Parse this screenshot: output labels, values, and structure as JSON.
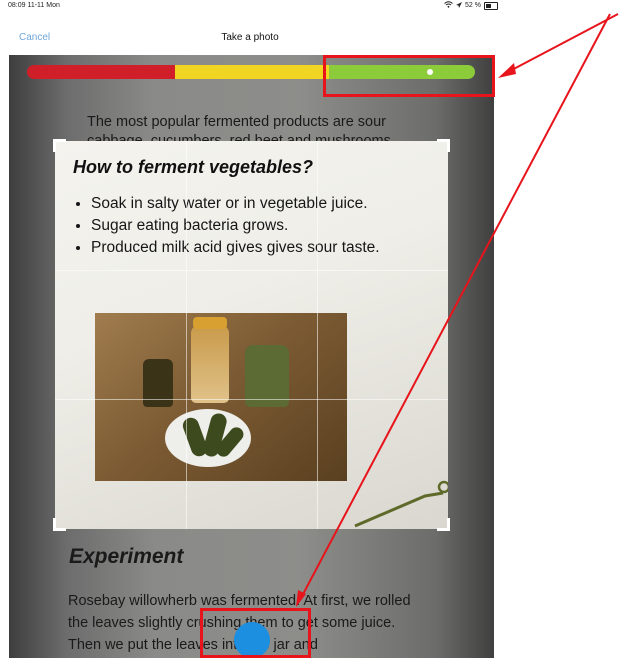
{
  "status_bar": {
    "time_date": "08:09 11-11 Mon",
    "battery": "52 %"
  },
  "nav": {
    "cancel_label": "Cancel",
    "title": "Take a photo"
  },
  "document": {
    "background_paragraph": "The most popular fermented products are sour cabbage, cucumbers, red beet and mushrooms, bread, kefir, curd herbs.",
    "card_title": "How to ferment vegetables?",
    "bullets": [
      "Soak in salty water or in vegetable juice.",
      "Sugar eating bacteria grows.",
      "Produced milk acid gives gives sour taste."
    ],
    "experiment_title": "Experiment",
    "experiment_text": "Rosebay willowherb was fermented. At first, we rolled the leaves slightly crushing them to get some juice. Then we put the leaves into the jar and"
  },
  "level_indicator": {
    "segments": [
      "red",
      "yellow",
      "green"
    ],
    "colors": {
      "red": "#d11f2a",
      "yellow": "#f0d623",
      "green": "#8ccb3a"
    },
    "level": 0.9
  },
  "shutter": {
    "color": "#1d8fe0",
    "icon": "shutter-button-icon"
  },
  "annotation": {
    "color": "#e8141c"
  }
}
